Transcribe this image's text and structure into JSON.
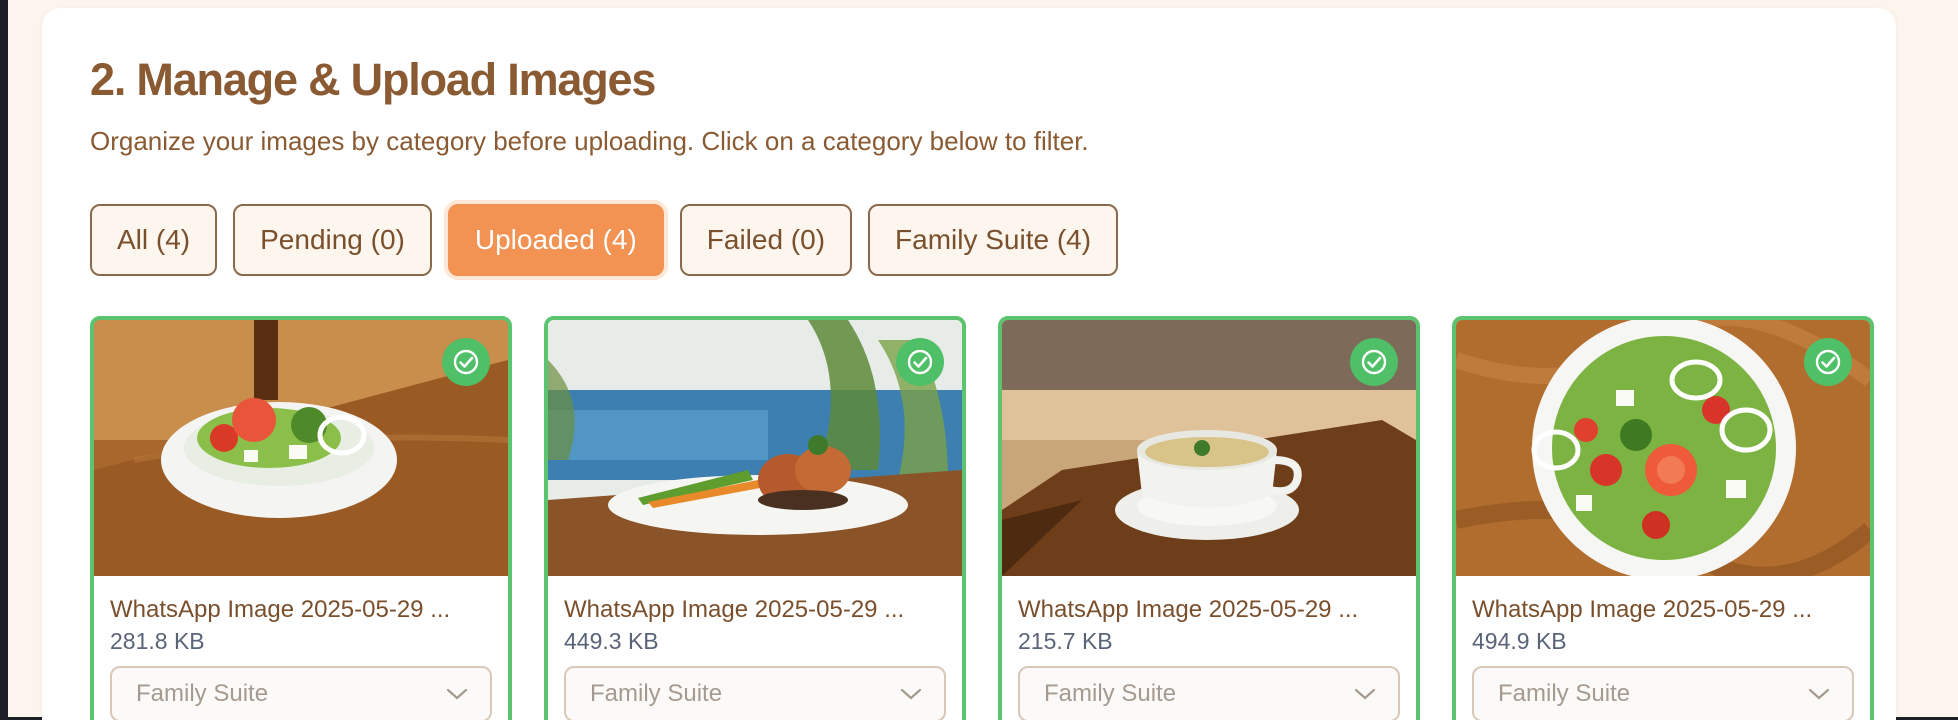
{
  "section": {
    "title": "2. Manage & Upload Images",
    "subtitle": "Organize your images by category before uploading. Click on a category below to filter."
  },
  "filters": [
    {
      "label": "All (4)",
      "active": false
    },
    {
      "label": "Pending (0)",
      "active": false
    },
    {
      "label": "Uploaded (4)",
      "active": true
    },
    {
      "label": "Failed (0)",
      "active": false
    },
    {
      "label": "Family Suite (4)",
      "active": false
    }
  ],
  "images": [
    {
      "name": "WhatsApp Image 2025-05-29 ...",
      "size": "281.8 KB",
      "category": "Family Suite",
      "status": "uploaded",
      "status_icon": "check-circle-icon"
    },
    {
      "name": "WhatsApp Image 2025-05-29 ...",
      "size": "449.3 KB",
      "category": "Family Suite",
      "status": "uploaded",
      "status_icon": "check-circle-icon"
    },
    {
      "name": "WhatsApp Image 2025-05-29 ...",
      "size": "215.7 KB",
      "category": "Family Suite",
      "status": "uploaded",
      "status_icon": "check-circle-icon"
    },
    {
      "name": "WhatsApp Image 2025-05-29 ...",
      "size": "494.9 KB",
      "category": "Family Suite",
      "status": "uploaded",
      "status_icon": "check-circle-icon"
    }
  ],
  "colors": {
    "heading": "#8a5a32",
    "accent": "#f29253",
    "success": "#5cc46e",
    "page_bg": "#fcf5ee"
  }
}
